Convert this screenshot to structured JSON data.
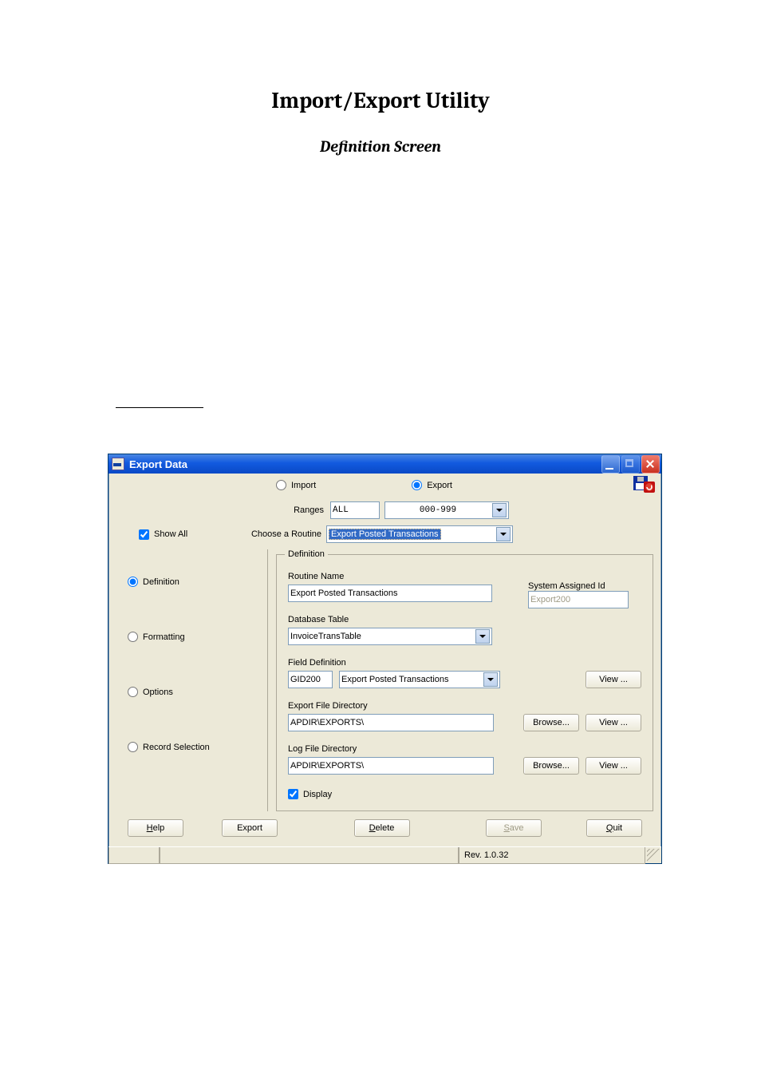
{
  "page": {
    "title": "Import/Export Utility",
    "subtitle": "Definition Screen"
  },
  "window": {
    "title": "Export Data",
    "mode": {
      "import_label": "Import",
      "export_label": "Export",
      "selected": "export"
    },
    "show_all": {
      "label": "Show All",
      "checked": true
    },
    "ranges": {
      "label": "Ranges",
      "code": "ALL",
      "range": "000-999"
    },
    "routine_select": {
      "label": "Choose a Routine",
      "value": "Export Posted Transactions"
    },
    "definition_group": {
      "legend": "Definition",
      "routine_name": {
        "label": "Routine Name",
        "value": "Export Posted Transactions"
      },
      "system_id": {
        "label": "System Assigned Id",
        "value": "Export200"
      },
      "db_table": {
        "label": "Database Table",
        "value": "InvoiceTransTable"
      },
      "field_def": {
        "label": "Field Definition",
        "code": "GID200",
        "value": "Export Posted Transactions",
        "view_label": "View ..."
      },
      "export_dir": {
        "label": "Export File Directory",
        "value": "APDIR\\EXPORTS\\",
        "browse_label": "Browse...",
        "view_label": "View ..."
      },
      "log_dir": {
        "label": "Log File Directory",
        "value": "APDIR\\EXPORTS\\",
        "browse_label": "Browse...",
        "view_label": "View ..."
      },
      "display": {
        "label": "Display",
        "checked": true
      }
    },
    "left_tabs": {
      "definition": "Definition",
      "formatting": "Formatting",
      "options": "Options",
      "record_selection": "Record Selection",
      "selected": "definition"
    },
    "buttons": {
      "help": "Help",
      "export": "Export",
      "delete": "Delete",
      "save": "Save",
      "quit": "Quit"
    },
    "status": {
      "rev": "Rev. 1.0.32"
    }
  }
}
